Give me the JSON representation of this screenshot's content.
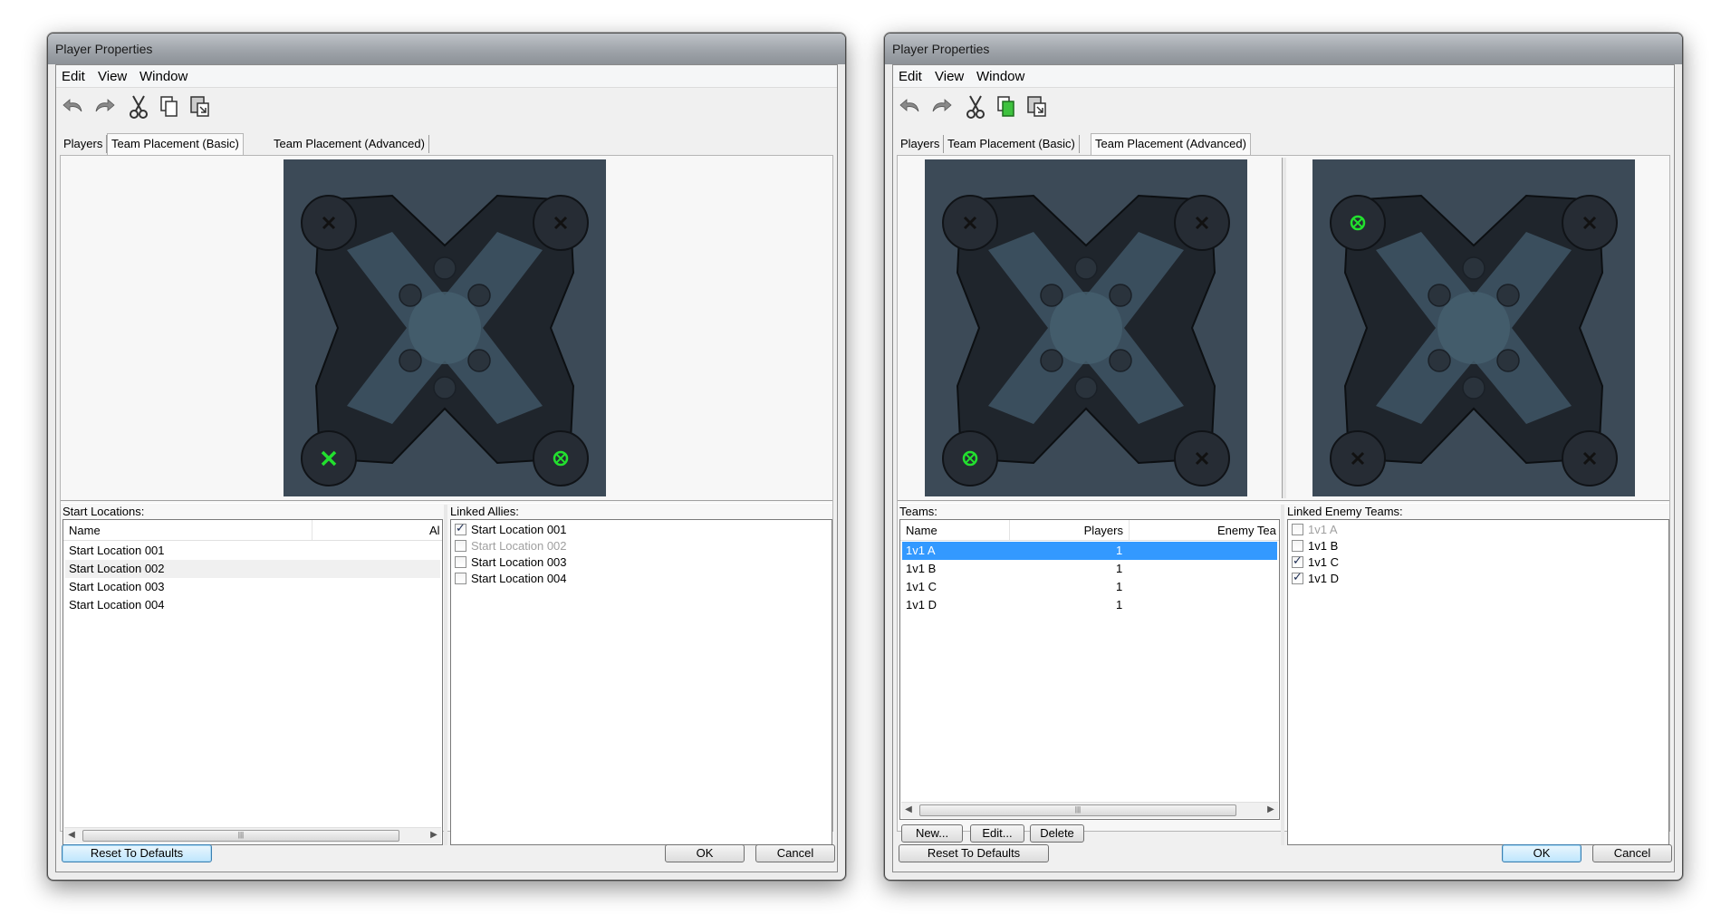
{
  "colors": {
    "map_background": "#3c4a57",
    "selection": "#3399ff",
    "marker_active": "#22e02e"
  },
  "left_window": {
    "title": "Player Properties",
    "menu": [
      "Edit",
      "View",
      "Window"
    ],
    "toolbar": [
      "undo-icon",
      "redo-icon",
      "cut-icon",
      "copy-icon",
      "paste-icon"
    ],
    "tabs": [
      "Players",
      "Team Placement (Basic)",
      "Team Placement (Advanced)"
    ],
    "active_tab": "Team Placement (Basic)",
    "start_locations": {
      "label": "Start Locations:",
      "columns": [
        "Name",
        "Al"
      ],
      "rows": [
        "Start Location 001",
        "Start Location 002",
        "Start Location 003",
        "Start Location 004"
      ],
      "hovered_row": "Start Location 002"
    },
    "linked_allies": {
      "label": "Linked Allies:",
      "items": [
        {
          "label": "Start Location 001",
          "checked": true,
          "disabled": false
        },
        {
          "label": "Start Location 002",
          "checked": false,
          "disabled": true
        },
        {
          "label": "Start Location 003",
          "checked": false,
          "disabled": false
        },
        {
          "label": "Start Location 004",
          "checked": false,
          "disabled": false
        }
      ]
    },
    "footer": {
      "reset": "Reset To Defaults",
      "ok": "OK",
      "cancel": "Cancel"
    }
  },
  "right_window": {
    "title": "Player Properties",
    "menu": [
      "Edit",
      "View",
      "Window"
    ],
    "toolbar": [
      "undo-icon",
      "redo-icon",
      "cut-icon",
      "copy-icon",
      "paste-icon"
    ],
    "tabs": [
      "Players",
      "Team Placement (Basic)",
      "Team Placement (Advanced)"
    ],
    "active_tab": "Team Placement (Advanced)",
    "teams": {
      "label": "Teams:",
      "columns": [
        "Name",
        "Players",
        "Enemy Tea"
      ],
      "rows": [
        {
          "name": "1v1 A",
          "players": "1"
        },
        {
          "name": "1v1 B",
          "players": "1"
        },
        {
          "name": "1v1 C",
          "players": "1"
        },
        {
          "name": "1v1 D",
          "players": "1"
        }
      ],
      "selected_row": "1v1 A",
      "buttons": {
        "new": "New...",
        "edit": "Edit...",
        "delete": "Delete"
      }
    },
    "linked_enemy_teams": {
      "label": "Linked Enemy Teams:",
      "items": [
        {
          "label": "1v1 A",
          "checked": false,
          "disabled": true
        },
        {
          "label": "1v1 B",
          "checked": false,
          "disabled": false
        },
        {
          "label": "1v1 C",
          "checked": true,
          "disabled": false
        },
        {
          "label": "1v1 D",
          "checked": true,
          "disabled": false
        }
      ]
    },
    "footer": {
      "reset": "Reset To Defaults",
      "ok": "OK",
      "cancel": "Cancel"
    }
  }
}
